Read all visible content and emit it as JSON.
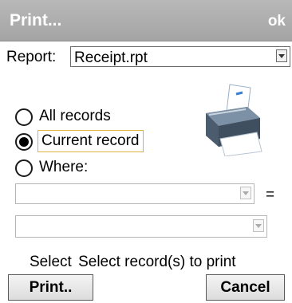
{
  "window": {
    "title": "Print...",
    "ok_label": "ok"
  },
  "report": {
    "label": "Report:",
    "value": "Receipt.rpt"
  },
  "options": {
    "all_records": "All records",
    "current_record": "Current record",
    "where": "Where:",
    "selected": "current_record"
  },
  "where_clause": {
    "field_value": "",
    "operator": "=",
    "value": ""
  },
  "status": {
    "prefix": "Select",
    "text": "Select record(s) to print"
  },
  "buttons": {
    "print": "Print..",
    "cancel": "Cancel"
  }
}
